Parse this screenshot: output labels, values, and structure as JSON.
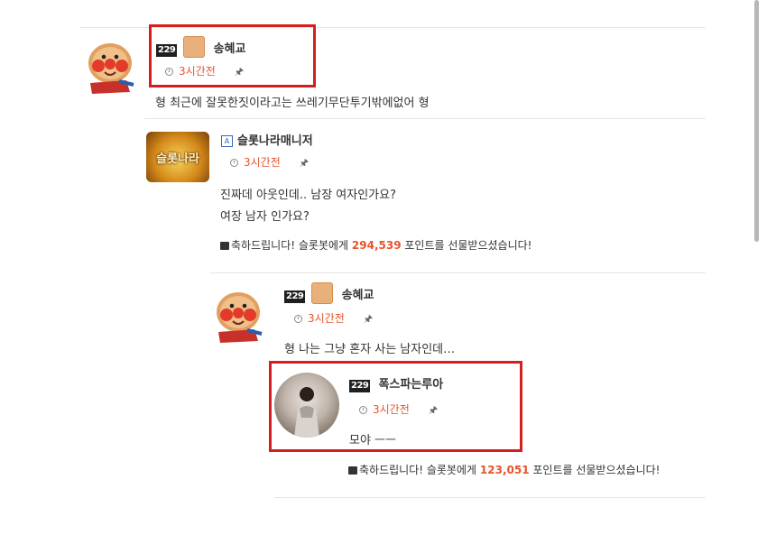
{
  "comments": [
    {
      "level": "229",
      "nickname": "송혜교",
      "time": "3시간전",
      "body": "형 최근에 잘못한짓이라고는 쓰레기무단투기밖에없어 형"
    },
    {
      "badge": "A",
      "nickname": "슬롯나라매니저",
      "time": "3시간전",
      "body_lines": [
        "진짜데 아웃인데.. 남장 여자인가요?",
        "여장 남자 인가요?"
      ],
      "gift": {
        "prefix": "축하드립니다! 슬롯봇에게 ",
        "points": "294,539",
        "suffix": " 포인트를 선물받으셨습니다!"
      }
    },
    {
      "level": "229",
      "nickname": "송혜교",
      "time": "3시간전",
      "body": "형 나는 그냥 혼자 사는 남자인데…"
    },
    {
      "level": "229",
      "nickname": "폭스파는루아",
      "time": "3시간전",
      "body": "모야 ㅡㅡ",
      "gift": {
        "prefix": "축하드립니다! 슬롯봇에게 ",
        "points": "123,051",
        "suffix": " 포인트를 선물받으셨습니다!"
      }
    }
  ],
  "manager_avatar_text": "슬롯나라",
  "icons": {
    "clock": "clock-icon",
    "pin": "pin-icon",
    "gift": "gift-icon"
  },
  "colors": {
    "accent": "#e8532b",
    "highlight_border": "#d41f1f"
  }
}
